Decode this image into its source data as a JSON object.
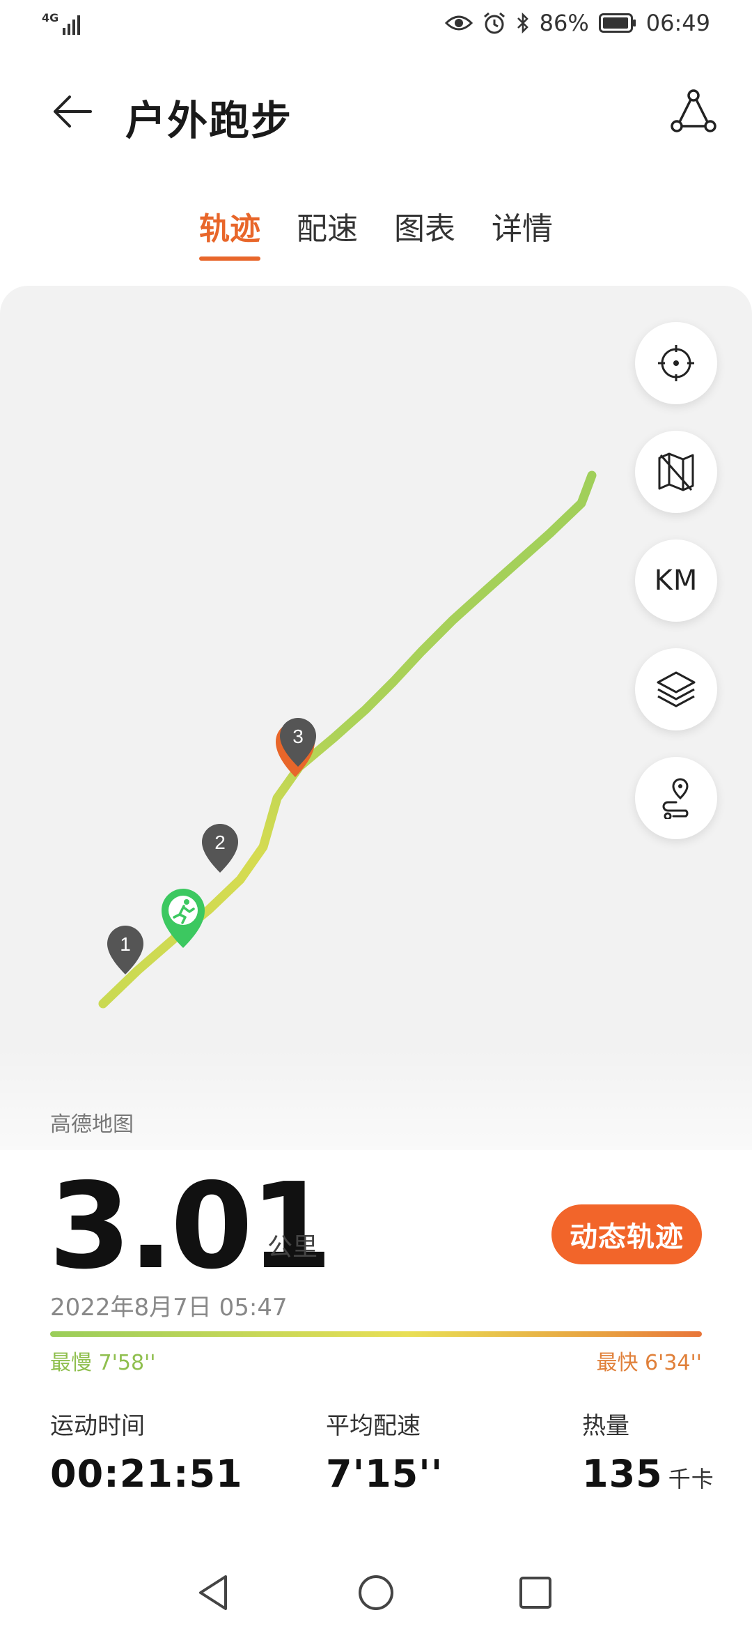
{
  "status_bar": {
    "network": "4G",
    "battery": "86%",
    "time": "06:49"
  },
  "header": {
    "title": "户外跑步",
    "back_icon": "arrow-left-icon",
    "route_icon": "route-share-icon"
  },
  "tabs": [
    {
      "label": "轨迹",
      "active": true
    },
    {
      "label": "配速",
      "active": false
    },
    {
      "label": "图表",
      "active": false
    },
    {
      "label": "详情",
      "active": false
    }
  ],
  "map": {
    "source": "高德地图",
    "controls": [
      {
        "name": "locate",
        "icon": "crosshair-icon"
      },
      {
        "name": "hide-map",
        "icon": "map-off-icon"
      },
      {
        "name": "km-markers",
        "label": "KM"
      },
      {
        "name": "layers",
        "icon": "layers-icon"
      },
      {
        "name": "route-points",
        "icon": "route-pin-icon"
      }
    ],
    "km_markers": [
      "1",
      "2",
      "3"
    ],
    "colors": {
      "track_slow": "#9acd5a",
      "track_fast": "#e8d84a",
      "start": "#3cc860",
      "end": "#e8662a",
      "marker": "#555555"
    }
  },
  "summary": {
    "distance": "3.01",
    "distance_unit": "公里",
    "datetime": "2022年8月7日 05:47",
    "dynamic_track_label": "动态轨迹",
    "slowest_label": "最慢 7'58''",
    "fastest_label": "最快 6'34''"
  },
  "stats": [
    {
      "label": "运动时间",
      "value": "00:21:51",
      "unit": ""
    },
    {
      "label": "平均配速",
      "value": "7'15''",
      "unit": ""
    },
    {
      "label": "热量",
      "value": "135",
      "unit": "千卡"
    }
  ],
  "accent_color": "#e8662a"
}
